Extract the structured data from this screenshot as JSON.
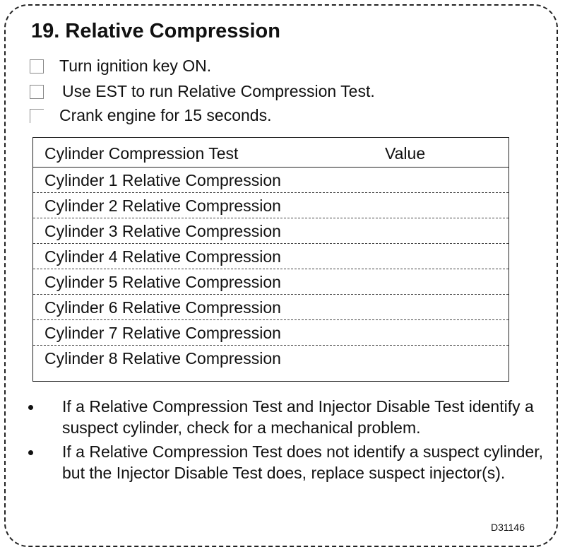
{
  "title": "19. Relative Compression",
  "steps": [
    "Turn ignition key ON.",
    "Use EST to run Relative Compression Test.",
    "Crank engine for 15 seconds."
  ],
  "table": {
    "headers": [
      "Cylinder Compression Test",
      "Value"
    ],
    "rows": [
      {
        "test": "Cylinder 1 Relative Compression",
        "value": ""
      },
      {
        "test": "Cylinder 2 Relative Compression",
        "value": ""
      },
      {
        "test": "Cylinder 3 Relative Compression",
        "value": ""
      },
      {
        "test": "Cylinder 4 Relative Compression",
        "value": ""
      },
      {
        "test": "Cylinder 5 Relative Compression",
        "value": ""
      },
      {
        "test": "Cylinder 6 Relative Compression",
        "value": ""
      },
      {
        "test": "Cylinder 7 Relative Compression",
        "value": ""
      },
      {
        "test": "Cylinder 8 Relative Compression",
        "value": ""
      }
    ]
  },
  "notes": [
    "If a Relative Compression Test and Injector Disable Test identify a suspect cylinder, check for a mechanical problem.",
    "If a Relative Compression Test does not identify a suspect cylinder, but the Injector Disable Test does, replace suspect  injector(s)."
  ],
  "figure_code": "D31146"
}
